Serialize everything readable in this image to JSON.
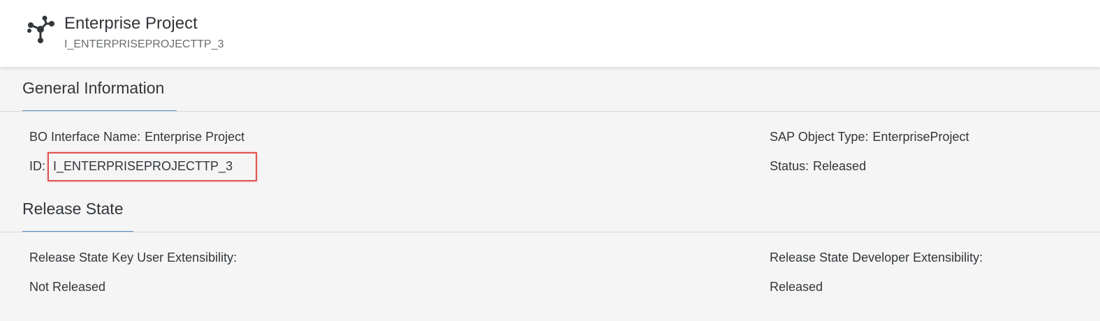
{
  "header": {
    "icon": "network-nodes-icon",
    "title": "Enterprise Project",
    "subtitle": "I_ENTERPRISEPROJECTTP_3"
  },
  "general": {
    "title": "General Information",
    "bo_interface_name_label": "BO Interface Name:",
    "bo_interface_name_value": "Enterprise Project",
    "id_label": "ID:",
    "id_value": "I_ENTERPRISEPROJECTTP_3",
    "sap_object_type_label": "SAP Object Type:",
    "sap_object_type_value": "EnterpriseProject",
    "status_label": "Status:",
    "status_value": "Released"
  },
  "release_state": {
    "title": "Release State",
    "key_user_label": "Release State Key User Extensibility:",
    "key_user_value": "Not Released",
    "developer_label": "Release State Developer Extensibility:",
    "developer_value": "Released"
  },
  "colors": {
    "accent": "#5b8fc7",
    "highlight": "#e05252",
    "background": "#f5f5f5"
  }
}
